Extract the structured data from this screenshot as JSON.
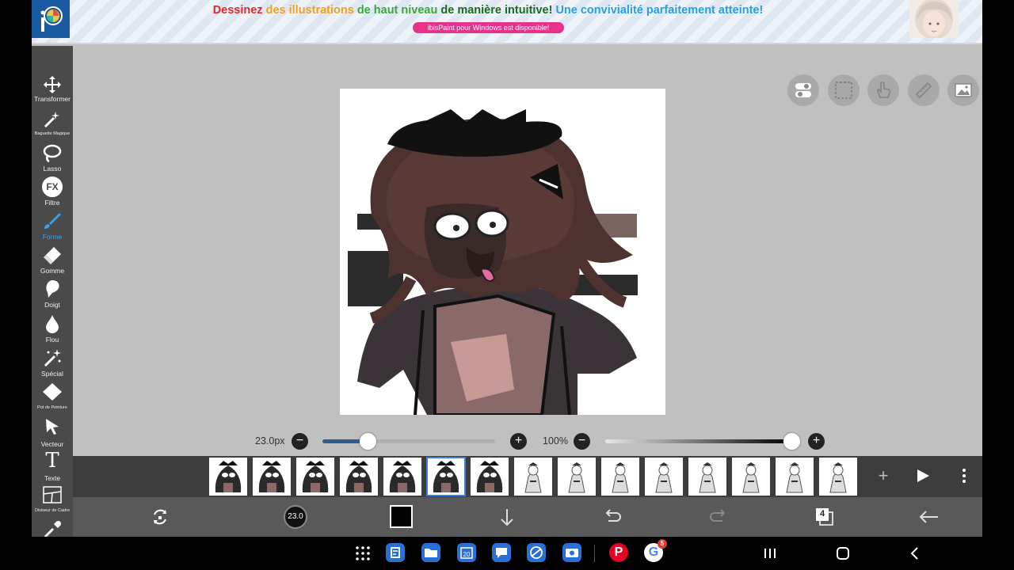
{
  "banner": {
    "headline": {
      "part1": "Dessinez",
      "part2": "des illustrations",
      "part3": "de haut niveau",
      "part4": "de manière intuitive!",
      "part5": "Une convivialité parfaitement atteinte!"
    },
    "pill": "ibisPaint pour Windows est disponible!",
    "logo_text": "i"
  },
  "tools": [
    {
      "label": "Transformer",
      "icon": "move-arrows-icon"
    },
    {
      "label": "Baguette Magique",
      "icon": "magic-wand-icon"
    },
    {
      "label": "Lasso",
      "icon": "lasso-icon"
    },
    {
      "label": "Filtre",
      "icon": "fx-icon"
    },
    {
      "label": "Forme",
      "icon": "brush-icon",
      "active": true
    },
    {
      "label": "Gomme",
      "icon": "eraser-icon"
    },
    {
      "label": "Doigt",
      "icon": "finger-icon"
    },
    {
      "label": "Flou",
      "icon": "blur-drop-icon"
    },
    {
      "label": "Spécial",
      "icon": "sparkle-icon"
    },
    {
      "label": "Pot de Peinture",
      "icon": "paint-bucket-icon"
    },
    {
      "label": "Vecteur",
      "icon": "vector-cursor-icon"
    },
    {
      "label": "Texte",
      "icon": "text-icon"
    },
    {
      "label": "Diviseur de Cadre",
      "icon": "frame-divider-icon"
    },
    {
      "label": "",
      "icon": "eyedropper-icon"
    }
  ],
  "fx_text": "FX",
  "text_tool_glyph": "T",
  "slider": {
    "brush_size_text": "23.0px",
    "brush_size_fraction": 0.26,
    "opacity_text": "100%",
    "opacity_fraction": 1.0
  },
  "frames": {
    "count": 15,
    "selected_index": 5
  },
  "bottom": {
    "brush_size_badge": "23.0",
    "layer_count": "4",
    "color": "#000000"
  },
  "android": {
    "google_badge": "5",
    "pinterest_glyph": "P",
    "google_glyph": "G"
  },
  "colors": {
    "accent": "#3aa0f0",
    "pill": "#e6338a",
    "toolbar": "#4a4a4a",
    "canvas_bg": "#c0c0c0"
  }
}
